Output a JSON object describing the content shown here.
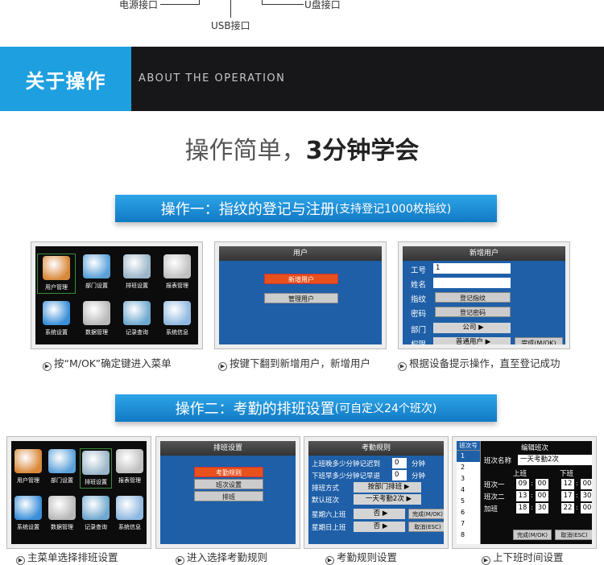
{
  "top": {
    "power_label": "电源接口",
    "usb_label": "USB接口",
    "udisk_label": "U盘接口"
  },
  "banner": {
    "title": "关于操作",
    "subtitle": "ABOUT THE OPERATION"
  },
  "headline": {
    "light": "操作简单，",
    "bold": "3分钟学会"
  },
  "op1": {
    "title": "操作一：指纹的登记与注册",
    "note": "(支持登记1000枚指纹)"
  },
  "op2": {
    "title": "操作二：考勤的排班设置",
    "note": "(可自定义24个班次)"
  },
  "main_menu": {
    "items": [
      "用户管理",
      "部门设置",
      "排班设置",
      "报表管理",
      "系统设置",
      "数据管理",
      "记录查询",
      "系统信息"
    ]
  },
  "user_screen": {
    "header": "用户",
    "items": [
      "新增用户",
      "管理用户"
    ]
  },
  "add_user": {
    "header": "新增用户",
    "rows": [
      {
        "label": "工号",
        "value": "1"
      },
      {
        "label": "姓名",
        "value": ""
      },
      {
        "label": "指纹",
        "value": "登记指纹"
      },
      {
        "label": "密码",
        "value": "登记密码"
      },
      {
        "label": "部门",
        "value": "公司"
      },
      {
        "label": "权限",
        "value": "普通用户"
      }
    ],
    "done": "完成(M/OK)"
  },
  "captions1": [
    "按“M/OK”确定键进入菜单",
    "按键下翻到新增用户，新增用户",
    "根据设备提示操作，直至登记成功"
  ],
  "menu2": {
    "items": [
      "用户管理",
      "部门设置",
      "排班设置",
      "报表管理",
      "系统设置",
      "数据管理",
      "记录查询",
      "系统信息"
    ]
  },
  "schedule_screen": {
    "header": "排班设置",
    "items": [
      "考勤规则",
      "班次设置",
      "排班"
    ]
  },
  "rules_screen": {
    "header": "考勤规则",
    "rows": [
      {
        "label": "上班晚多少分钟记迟到",
        "value": "0",
        "unit": "分钟"
      },
      {
        "label": "下班早多少分钟记早退",
        "value": "0",
        "unit": "分钟"
      },
      {
        "label": "排班方式",
        "value": "按部门排班"
      },
      {
        "label": "默认班次",
        "value": "一天考勤2次"
      },
      {
        "label": "星期六上班",
        "value": "否"
      },
      {
        "label": "星期日上班",
        "value": "否"
      }
    ],
    "done": "完成(M/OK)",
    "cancel": "取消(ESC)"
  },
  "shift_screen": {
    "list_header": "班次号",
    "list": [
      "1",
      "2",
      "3",
      "4",
      "5",
      "6",
      "7",
      "8"
    ],
    "header": "编辑班次",
    "name_label": "班次名称",
    "name_value": "一天考勤2次",
    "on": "上班",
    "off": "下班",
    "rows": [
      {
        "label": "班次一",
        "a": "09",
        "b": "00",
        "c": "12",
        "d": "00"
      },
      {
        "label": "班次二",
        "a": "13",
        "b": "00",
        "c": "17",
        "d": "30"
      },
      {
        "label": "加班",
        "a": "18",
        "b": "30",
        "c": "22",
        "d": "00"
      }
    ],
    "done": "完成(M/OK)",
    "cancel": "取消(ESC)"
  },
  "captions2": [
    "主菜单选择排班设置",
    "进入选择考勤规则",
    "考勤规则设置",
    "上下班时间设置"
  ]
}
